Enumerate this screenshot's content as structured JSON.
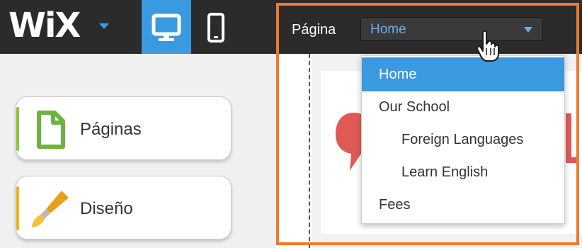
{
  "header": {
    "logo_text": "WiX",
    "page_label": "Página",
    "page_select_value": "Home"
  },
  "sidebar": {
    "buttons": [
      {
        "label": "Páginas",
        "icon": "page-icon",
        "accent": "#8cc63f"
      },
      {
        "label": "Diseño",
        "icon": "paintbrush-icon",
        "accent": "#f3b51f"
      }
    ]
  },
  "dropdown": {
    "items": [
      {
        "label": "Home",
        "selected": true
      },
      {
        "label": "Our School",
        "selected": false
      },
      {
        "label": "Foreign Languages",
        "selected": false
      },
      {
        "label": "Learn English",
        "selected": false
      },
      {
        "label": "Fees",
        "selected": false
      }
    ]
  },
  "colors": {
    "topbar": "#2b2b2b",
    "accent_blue": "#3b99e0",
    "highlight_orange": "#ef7a2c",
    "preview_red": "#e05a55"
  }
}
